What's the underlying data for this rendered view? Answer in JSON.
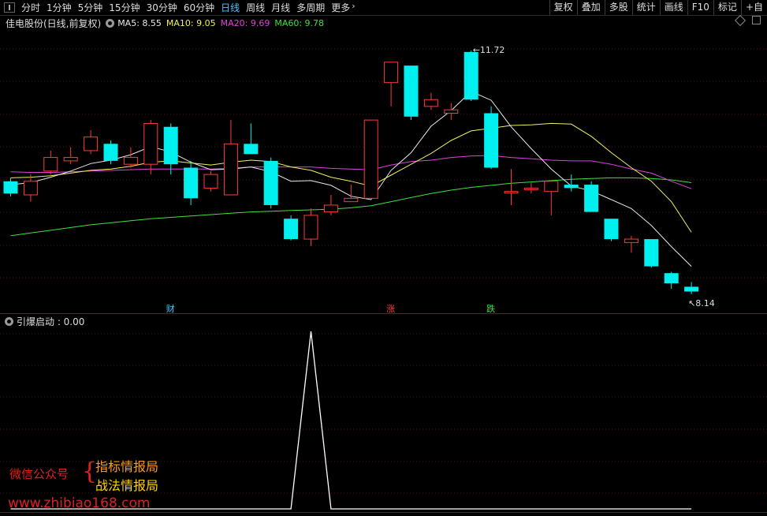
{
  "toolbar": {
    "periods": [
      "分时",
      "1分钟",
      "5分钟",
      "15分钟",
      "30分钟",
      "60分钟",
      "日线",
      "周线",
      "月线",
      "多周期",
      "更多"
    ],
    "active": "日线",
    "right_buttons": [
      "复权",
      "叠加",
      "多股",
      "统计",
      "画线",
      "F10",
      "标记",
      "+自"
    ]
  },
  "title": {
    "stock": "佳电股份(日线,前复权)",
    "ma": [
      {
        "label": "MA5: 8.55",
        "color": "#e8e8e8"
      },
      {
        "label": "MA10: 9.05",
        "color": "#f0f060"
      },
      {
        "label": "MA20: 9.69",
        "color": "#e040e0"
      },
      {
        "label": "MA60: 9.78",
        "color": "#40e040"
      }
    ]
  },
  "price_labels": {
    "high": "11.72",
    "low": "8.14"
  },
  "event_tags": [
    {
      "text": "财",
      "color": "#4fc3ff"
    },
    {
      "text": "涨",
      "color": "#ff4040"
    },
    {
      "text": "跌",
      "color": "#40e040"
    }
  ],
  "indicator": {
    "label": "引爆启动 : 0.00"
  },
  "watermark": {
    "line1": "微信公众号",
    "brace": "{",
    "line2": "指标情报局",
    "line3": "战法情报局",
    "line4": "www.zhibiao168.com"
  },
  "colors": {
    "up": "#ff3a3a",
    "down": "#00f0f0",
    "ma5": "#e8e8e8",
    "ma10": "#f0f060",
    "ma20": "#e040e0",
    "ma60": "#40e040"
  },
  "chart_data": {
    "type": "candlestick",
    "candles": [
      {
        "o": 9.8,
        "c": 9.62,
        "h": 9.85,
        "l": 9.58
      },
      {
        "o": 9.6,
        "c": 9.8,
        "h": 9.9,
        "l": 9.5
      },
      {
        "o": 9.95,
        "c": 10.15,
        "h": 10.25,
        "l": 9.9
      },
      {
        "o": 10.1,
        "c": 10.15,
        "h": 10.3,
        "l": 10.05
      },
      {
        "o": 10.25,
        "c": 10.45,
        "h": 10.55,
        "l": 10.2
      },
      {
        "o": 10.35,
        "c": 10.1,
        "h": 10.4,
        "l": 10.05
      },
      {
        "o": 10.05,
        "c": 10.15,
        "h": 10.3,
        "l": 10.0
      },
      {
        "o": 10.05,
        "c": 10.65,
        "h": 10.7,
        "l": 9.9
      },
      {
        "o": 10.6,
        "c": 10.05,
        "h": 10.65,
        "l": 9.9
      },
      {
        "o": 10.0,
        "c": 9.55,
        "h": 10.1,
        "l": 9.45
      },
      {
        "o": 9.7,
        "c": 9.9,
        "h": 9.95,
        "l": 9.65
      },
      {
        "o": 9.6,
        "c": 10.35,
        "h": 10.7,
        "l": 9.6
      },
      {
        "o": 10.35,
        "c": 10.2,
        "h": 10.65,
        "l": 10.2
      },
      {
        "o": 10.1,
        "c": 9.45,
        "h": 10.15,
        "l": 9.4
      },
      {
        "o": 9.25,
        "c": 8.95,
        "h": 9.3,
        "l": 8.93
      },
      {
        "o": 8.95,
        "c": 9.3,
        "h": 9.4,
        "l": 8.85
      },
      {
        "o": 9.35,
        "c": 9.45,
        "h": 9.6,
        "l": 9.3
      },
      {
        "o": 9.5,
        "c": 9.55,
        "h": 9.75,
        "l": 9.5
      },
      {
        "o": 9.55,
        "c": 10.7,
        "h": 10.7,
        "l": 9.55
      },
      {
        "o": 11.25,
        "c": 11.55,
        "h": 11.55,
        "l": 10.9
      },
      {
        "o": 11.5,
        "c": 10.75,
        "h": 11.5,
        "l": 10.7
      },
      {
        "o": 10.9,
        "c": 11.0,
        "h": 11.1,
        "l": 10.85
      },
      {
        "o": 10.8,
        "c": 10.85,
        "h": 10.95,
        "l": 10.7
      },
      {
        "o": 11.7,
        "c": 11.0,
        "h": 11.72,
        "l": 10.98
      },
      {
        "o": 10.8,
        "c": 10.0,
        "h": 10.9,
        "l": 9.98
      },
      {
        "o": 9.65,
        "c": 9.65,
        "h": 9.98,
        "l": 9.45
      },
      {
        "o": 9.7,
        "c": 9.7,
        "h": 9.78,
        "l": 9.62
      },
      {
        "o": 9.65,
        "c": 9.8,
        "h": 9.8,
        "l": 9.3
      },
      {
        "o": 9.75,
        "c": 9.7,
        "h": 9.9,
        "l": 9.65
      },
      {
        "o": 9.75,
        "c": 9.35,
        "h": 9.8,
        "l": 9.35
      },
      {
        "o": 9.25,
        "c": 8.95,
        "h": 9.25,
        "l": 8.92
      },
      {
        "o": 8.9,
        "c": 8.95,
        "h": 9.0,
        "l": 8.75
      },
      {
        "o": 8.95,
        "c": 8.55,
        "h": 8.95,
        "l": 8.53
      },
      {
        "o": 8.45,
        "c": 8.3,
        "h": 8.47,
        "l": 8.22
      },
      {
        "o": 8.25,
        "c": 8.18,
        "h": 8.32,
        "l": 8.14
      }
    ],
    "ma5": [
      9.75,
      9.78,
      9.86,
      9.95,
      10.06,
      10.11,
      10.19,
      10.31,
      10.23,
      10.08,
      9.97,
      9.98,
      10.01,
      9.94,
      9.8,
      9.81,
      9.74,
      9.58,
      9.53,
      9.96,
      10.22,
      10.61,
      10.84,
      11.12,
      10.99,
      10.6,
      10.28,
      9.98,
      9.73,
      9.66,
      9.53,
      9.4,
      9.15,
      8.84,
      8.55
    ],
    "ma10": [
      9.85,
      9.86,
      9.88,
      9.92,
      9.96,
      9.98,
      10.02,
      10.08,
      10.1,
      10.07,
      10.04,
      10.08,
      10.11,
      10.09,
      10.01,
      9.96,
      9.86,
      9.8,
      9.73,
      9.89,
      10.05,
      10.21,
      10.4,
      10.54,
      10.58,
      10.62,
      10.63,
      10.65,
      10.64,
      10.46,
      10.22,
      10.0,
      9.8,
      9.5,
      9.05
    ],
    "ma20": [
      9.94,
      9.93,
      9.93,
      9.94,
      9.95,
      9.96,
      9.97,
      9.98,
      9.98,
      9.98,
      9.98,
      9.99,
      10.01,
      10.01,
      10.01,
      10.01,
      9.99,
      9.98,
      9.97,
      10.04,
      10.09,
      10.11,
      10.15,
      10.17,
      10.18,
      10.15,
      10.13,
      10.11,
      10.1,
      10.1,
      10.05,
      9.98,
      9.92,
      9.8,
      9.69
    ],
    "ma60": [
      9.0,
      9.04,
      9.08,
      9.12,
      9.16,
      9.19,
      9.22,
      9.25,
      9.27,
      9.29,
      9.31,
      9.33,
      9.35,
      9.36,
      9.37,
      9.38,
      9.39,
      9.41,
      9.44,
      9.5,
      9.56,
      9.62,
      9.67,
      9.71,
      9.74,
      9.77,
      9.79,
      9.81,
      9.83,
      9.84,
      9.85,
      9.85,
      9.84,
      9.82,
      9.78
    ],
    "indicator_values": [
      0,
      0,
      0,
      0,
      0,
      0,
      0,
      0,
      0,
      0,
      0,
      0,
      0,
      0,
      0,
      1,
      0,
      0,
      0,
      0,
      0,
      0,
      0,
      0,
      0,
      0,
      0,
      0,
      0,
      0,
      0,
      0,
      0,
      0,
      0
    ],
    "ylim": [
      8.0,
      12.0
    ]
  }
}
